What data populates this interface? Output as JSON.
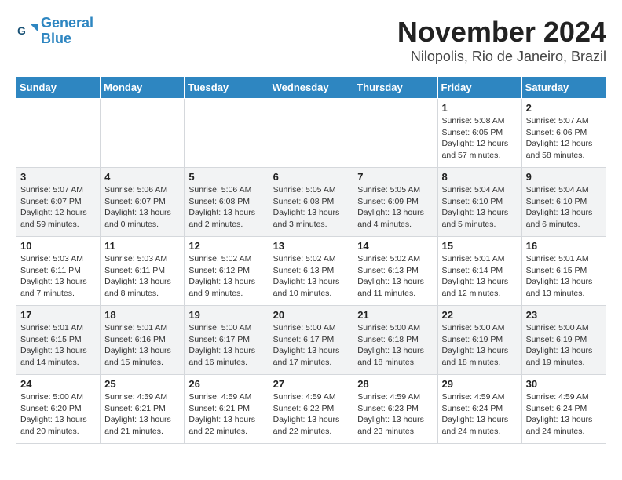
{
  "header": {
    "logo_line1": "General",
    "logo_line2": "Blue",
    "month": "November 2024",
    "location": "Nilopolis, Rio de Janeiro, Brazil"
  },
  "weekdays": [
    "Sunday",
    "Monday",
    "Tuesday",
    "Wednesday",
    "Thursday",
    "Friday",
    "Saturday"
  ],
  "weeks": [
    [
      {
        "day": "",
        "info": ""
      },
      {
        "day": "",
        "info": ""
      },
      {
        "day": "",
        "info": ""
      },
      {
        "day": "",
        "info": ""
      },
      {
        "day": "",
        "info": ""
      },
      {
        "day": "1",
        "info": "Sunrise: 5:08 AM\nSunset: 6:05 PM\nDaylight: 12 hours\nand 57 minutes."
      },
      {
        "day": "2",
        "info": "Sunrise: 5:07 AM\nSunset: 6:06 PM\nDaylight: 12 hours\nand 58 minutes."
      }
    ],
    [
      {
        "day": "3",
        "info": "Sunrise: 5:07 AM\nSunset: 6:07 PM\nDaylight: 12 hours\nand 59 minutes."
      },
      {
        "day": "4",
        "info": "Sunrise: 5:06 AM\nSunset: 6:07 PM\nDaylight: 13 hours\nand 0 minutes."
      },
      {
        "day": "5",
        "info": "Sunrise: 5:06 AM\nSunset: 6:08 PM\nDaylight: 13 hours\nand 2 minutes."
      },
      {
        "day": "6",
        "info": "Sunrise: 5:05 AM\nSunset: 6:08 PM\nDaylight: 13 hours\nand 3 minutes."
      },
      {
        "day": "7",
        "info": "Sunrise: 5:05 AM\nSunset: 6:09 PM\nDaylight: 13 hours\nand 4 minutes."
      },
      {
        "day": "8",
        "info": "Sunrise: 5:04 AM\nSunset: 6:10 PM\nDaylight: 13 hours\nand 5 minutes."
      },
      {
        "day": "9",
        "info": "Sunrise: 5:04 AM\nSunset: 6:10 PM\nDaylight: 13 hours\nand 6 minutes."
      }
    ],
    [
      {
        "day": "10",
        "info": "Sunrise: 5:03 AM\nSunset: 6:11 PM\nDaylight: 13 hours\nand 7 minutes."
      },
      {
        "day": "11",
        "info": "Sunrise: 5:03 AM\nSunset: 6:11 PM\nDaylight: 13 hours\nand 8 minutes."
      },
      {
        "day": "12",
        "info": "Sunrise: 5:02 AM\nSunset: 6:12 PM\nDaylight: 13 hours\nand 9 minutes."
      },
      {
        "day": "13",
        "info": "Sunrise: 5:02 AM\nSunset: 6:13 PM\nDaylight: 13 hours\nand 10 minutes."
      },
      {
        "day": "14",
        "info": "Sunrise: 5:02 AM\nSunset: 6:13 PM\nDaylight: 13 hours\nand 11 minutes."
      },
      {
        "day": "15",
        "info": "Sunrise: 5:01 AM\nSunset: 6:14 PM\nDaylight: 13 hours\nand 12 minutes."
      },
      {
        "day": "16",
        "info": "Sunrise: 5:01 AM\nSunset: 6:15 PM\nDaylight: 13 hours\nand 13 minutes."
      }
    ],
    [
      {
        "day": "17",
        "info": "Sunrise: 5:01 AM\nSunset: 6:15 PM\nDaylight: 13 hours\nand 14 minutes."
      },
      {
        "day": "18",
        "info": "Sunrise: 5:01 AM\nSunset: 6:16 PM\nDaylight: 13 hours\nand 15 minutes."
      },
      {
        "day": "19",
        "info": "Sunrise: 5:00 AM\nSunset: 6:17 PM\nDaylight: 13 hours\nand 16 minutes."
      },
      {
        "day": "20",
        "info": "Sunrise: 5:00 AM\nSunset: 6:17 PM\nDaylight: 13 hours\nand 17 minutes."
      },
      {
        "day": "21",
        "info": "Sunrise: 5:00 AM\nSunset: 6:18 PM\nDaylight: 13 hours\nand 18 minutes."
      },
      {
        "day": "22",
        "info": "Sunrise: 5:00 AM\nSunset: 6:19 PM\nDaylight: 13 hours\nand 18 minutes."
      },
      {
        "day": "23",
        "info": "Sunrise: 5:00 AM\nSunset: 6:19 PM\nDaylight: 13 hours\nand 19 minutes."
      }
    ],
    [
      {
        "day": "24",
        "info": "Sunrise: 5:00 AM\nSunset: 6:20 PM\nDaylight: 13 hours\nand 20 minutes."
      },
      {
        "day": "25",
        "info": "Sunrise: 4:59 AM\nSunset: 6:21 PM\nDaylight: 13 hours\nand 21 minutes."
      },
      {
        "day": "26",
        "info": "Sunrise: 4:59 AM\nSunset: 6:21 PM\nDaylight: 13 hours\nand 22 minutes."
      },
      {
        "day": "27",
        "info": "Sunrise: 4:59 AM\nSunset: 6:22 PM\nDaylight: 13 hours\nand 22 minutes."
      },
      {
        "day": "28",
        "info": "Sunrise: 4:59 AM\nSunset: 6:23 PM\nDaylight: 13 hours\nand 23 minutes."
      },
      {
        "day": "29",
        "info": "Sunrise: 4:59 AM\nSunset: 6:24 PM\nDaylight: 13 hours\nand 24 minutes."
      },
      {
        "day": "30",
        "info": "Sunrise: 4:59 AM\nSunset: 6:24 PM\nDaylight: 13 hours\nand 24 minutes."
      }
    ]
  ]
}
